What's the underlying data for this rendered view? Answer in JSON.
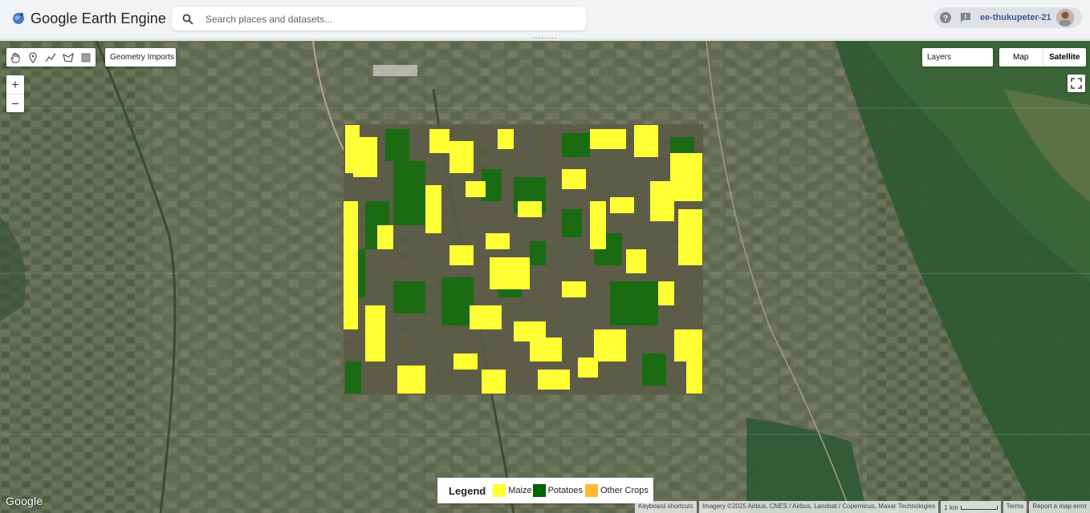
{
  "app": {
    "title": "Google Earth Engine"
  },
  "search": {
    "placeholder": "Search places and datasets..."
  },
  "account": {
    "username": "ee-thukupeter-21"
  },
  "map_controls": {
    "geometry_imports_label": "Geometry Imports",
    "layers_label": "Layers",
    "map_type_options": [
      "Map",
      "Satellite"
    ],
    "map_type_selected": "Satellite",
    "zoom_in": "+",
    "zoom_out": "−",
    "drawing_tools": [
      "hand-icon",
      "point-icon",
      "line-icon",
      "polygon-icon",
      "rectangle-icon"
    ]
  },
  "legend": {
    "title": "Legend",
    "items": [
      {
        "label": "Maize",
        "color": "#ffff33"
      },
      {
        "label": "Potatoes",
        "color": "#006400"
      },
      {
        "label": "Other Crops",
        "color": "#ffb833"
      }
    ]
  },
  "footer": {
    "google_logo": "Google",
    "keyboard_shortcuts": "Keyboard shortcuts",
    "imagery": "Imagery ©2025 Airbus, CNES / Airbus, Landsat / Copernicus, Maxar Technologies",
    "scale": "1 km",
    "terms": "Terms",
    "report": "Report a map error"
  }
}
